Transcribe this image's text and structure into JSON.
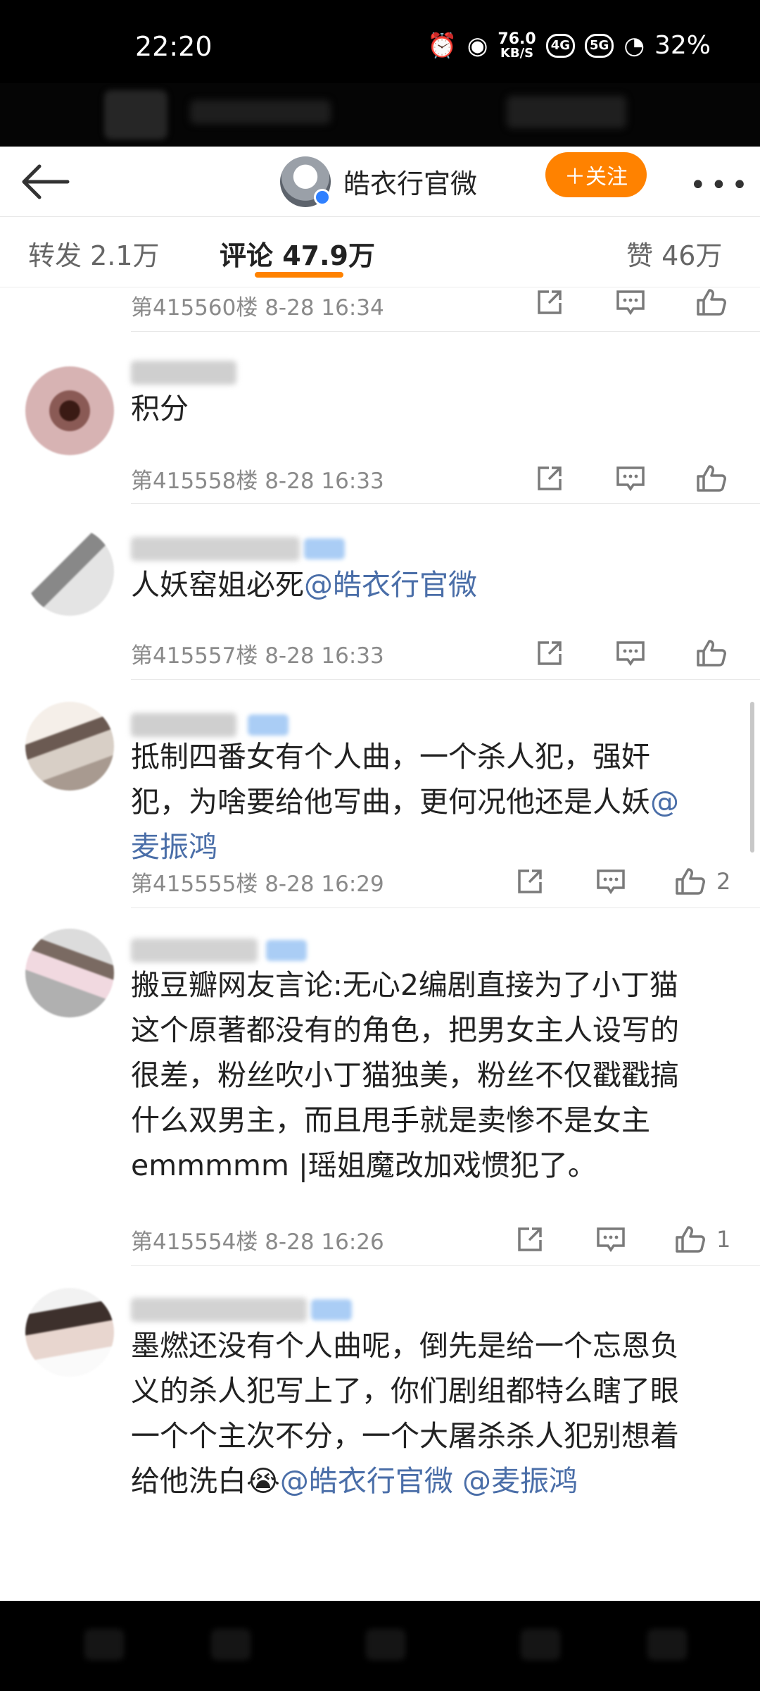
{
  "status_bar": {
    "time": "22:20",
    "net_speed_value": "76.0",
    "net_speed_unit": "KB/S",
    "sim1": "4G",
    "sim2": "5G",
    "battery": "32%"
  },
  "header": {
    "account_name": "皓衣行官微",
    "follow_label": "＋关注",
    "more_label": "•••"
  },
  "tabs": {
    "repost": "转发 2.1万",
    "comments": "评论 47.9万",
    "likes": "赞 46万"
  },
  "colors": {
    "accent": "#ff8200",
    "mention": "#4a6ea8",
    "meta_text": "#8a8a8a"
  },
  "comments": [
    {
      "meta": "第415560楼  8-28 16:34",
      "likes": ""
    },
    {
      "text": "积分",
      "meta": "第415558楼  8-28 16:33",
      "likes": ""
    },
    {
      "text": "人妖窑姐必死",
      "mention": "@皓衣行官微",
      "meta": "第415557楼  8-28 16:33",
      "likes": ""
    },
    {
      "line1": "抵制四番女有个人曲，一个杀人犯，强奸",
      "line2a": "犯，为啥要给他写曲，更何况他还是人妖",
      "line2b": "@",
      "line3": "麦振鸿",
      "meta": "第415555楼  8-28 16:29",
      "likes": "2"
    },
    {
      "line1": "搬豆瓣网友言论:无心2编剧直接为了小丁猫",
      "line2": "这个原著都没有的角色，把男女主人设写的",
      "line3": "很差，粉丝吹小丁猫独美，粉丝不仅戳戳搞",
      "line4": "什么双男主，而且甩手就是卖惨不是女主",
      "line5": "emmmmm |瑶姐魔改加戏惯犯了。",
      "meta": "第415554楼  8-28 16:26",
      "likes": "1"
    },
    {
      "line1": "墨燃还没有个人曲呢，倒先是给一个忘恩负",
      "line2": "义的杀人犯写上了，你们剧组都特么瞎了眼",
      "line3": "一个个主次不分，一个大屠杀杀人犯别想着",
      "line4a": "给他洗白😭",
      "mention1": "@皓衣行官微",
      "mention2": "@麦振鸿"
    }
  ],
  "icons": [
    "back-arrow-icon",
    "verified-icon",
    "more-icon",
    "repost-icon",
    "comment-icon",
    "like-icon"
  ]
}
